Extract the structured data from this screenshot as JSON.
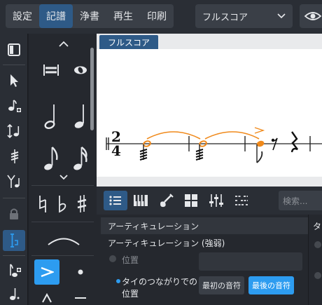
{
  "mode_tabs": [
    {
      "label": "設定",
      "active": false
    },
    {
      "label": "記譜",
      "active": true
    },
    {
      "label": "浄書",
      "active": false
    },
    {
      "label": "再生",
      "active": false
    },
    {
      "label": "印刷",
      "active": false
    }
  ],
  "score_select": {
    "value": "フルスコア"
  },
  "score_tab": {
    "label": "フルスコア"
  },
  "time_signature": {
    "numerator": "2",
    "denominator": "4"
  },
  "inspector": {
    "search_placeholder": "検索...",
    "section_title": "アーティキュレーション",
    "subsection": "アーティキュレーション (強弱)",
    "position_label": "位置",
    "tie_label": "タイのつながりでの位置",
    "tie_options": [
      {
        "label": "最初の音符",
        "active": false
      },
      {
        "label": "最後の音符",
        "active": true
      }
    ],
    "right_panel_letter": "タ"
  },
  "colors": {
    "accent_blue": "#2e5a87",
    "highlight_blue": "#2d9cf0",
    "selection_orange": "#f08a1c"
  }
}
